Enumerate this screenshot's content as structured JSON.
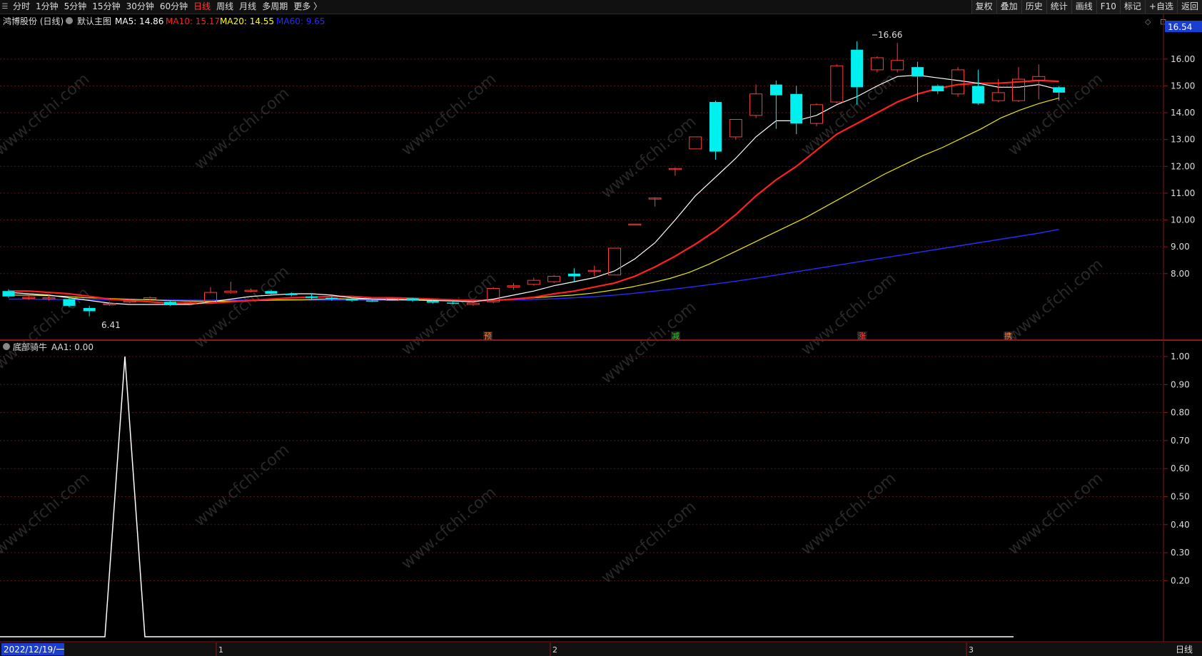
{
  "toolbar": {
    "periods": [
      "分时",
      "1分钟",
      "5分钟",
      "15分钟",
      "30分钟",
      "60分钟",
      "日线",
      "周线",
      "月线",
      "多周期",
      "更多 〉"
    ],
    "active_period": "日线",
    "right_buttons": [
      "复权",
      "叠加",
      "历史",
      "统计",
      "画线",
      "F10",
      "标记",
      "+自选",
      "返回"
    ]
  },
  "main_panel": {
    "stock_title": "鸿博股份 (日线)",
    "indicator_name": "默认主图",
    "ma_labels": [
      {
        "label": "MA5: 14.86",
        "color": "#ffffff"
      },
      {
        "label": "MA10: 15.17",
        "color": "#ff2020"
      },
      {
        "label": "MA20: 14.55",
        "color": "#ffff00"
      },
      {
        "label": "MA60: 9.65",
        "color": "#2a2aff"
      }
    ],
    "price_badge": "16.54",
    "high_label": "16.66",
    "low_label": "6.41",
    "y_ticks": [
      "16.00",
      "15.00",
      "14.00",
      "13.00",
      "12.00",
      "11.00",
      "10.00",
      "9.00",
      "8.00"
    ],
    "event_markers": [
      {
        "text": "预",
        "color": "#ff8040"
      },
      {
        "text": "减",
        "color": "#20d020"
      },
      {
        "text": "涨",
        "color": "#ff4040"
      },
      {
        "text": "携",
        "color": "#ff8040"
      }
    ],
    "watermark": "www.cfchi.com"
  },
  "sub_panel": {
    "indicator_name": "底部骑牛",
    "value_label": "AA1: 0.00",
    "y_ticks": [
      "1.00",
      "0.90",
      "0.80",
      "0.70",
      "0.60",
      "0.50",
      "0.40",
      "0.30",
      "0.20"
    ]
  },
  "bottom_bar": {
    "date_label": "2022/12/19/一",
    "month_ticks": [
      "1",
      "2",
      "3"
    ],
    "period_label": "日线"
  },
  "chart_data": {
    "type": "candlestick",
    "ylim": [
      6.0,
      16.9
    ],
    "candles": [
      {
        "o": 7.35,
        "c": 7.15,
        "h": 7.42,
        "l": 7.1
      },
      {
        "o": 7.1,
        "c": 7.12,
        "h": 7.2,
        "l": 7.02
      },
      {
        "o": 7.08,
        "c": 7.1,
        "h": 7.2,
        "l": 7.0
      },
      {
        "o": 7.05,
        "c": 6.8,
        "h": 7.1,
        "l": 6.75
      },
      {
        "o": 6.72,
        "c": 6.6,
        "h": 6.8,
        "l": 6.41
      },
      {
        "o": 6.85,
        "c": 6.88,
        "h": 6.95,
        "l": 6.8
      },
      {
        "o": 6.95,
        "c": 6.98,
        "h": 7.05,
        "l": 6.9
      },
      {
        "o": 7.05,
        "c": 7.1,
        "h": 7.15,
        "l": 7.0
      },
      {
        "o": 6.95,
        "c": 6.85,
        "h": 7.0,
        "l": 6.8
      },
      {
        "o": 6.9,
        "c": 6.92,
        "h": 6.98,
        "l": 6.85
      },
      {
        "o": 6.95,
        "c": 7.3,
        "h": 7.5,
        "l": 6.9
      },
      {
        "o": 7.3,
        "c": 7.35,
        "h": 7.7,
        "l": 7.25
      },
      {
        "o": 7.35,
        "c": 7.38,
        "h": 7.45,
        "l": 7.3
      },
      {
        "o": 7.35,
        "c": 7.25,
        "h": 7.4,
        "l": 7.2
      },
      {
        "o": 7.25,
        "c": 7.2,
        "h": 7.3,
        "l": 7.15
      },
      {
        "o": 7.15,
        "c": 7.1,
        "h": 7.25,
        "l": 7.05
      },
      {
        "o": 7.1,
        "c": 7.05,
        "h": 7.15,
        "l": 7.0
      },
      {
        "o": 7.05,
        "c": 7.0,
        "h": 7.1,
        "l": 6.95
      },
      {
        "o": 7.0,
        "c": 6.98,
        "h": 7.05,
        "l": 6.95
      },
      {
        "o": 7.0,
        "c": 7.08,
        "h": 7.12,
        "l": 6.98
      },
      {
        "o": 7.08,
        "c": 7.0,
        "h": 7.1,
        "l": 6.95
      },
      {
        "o": 6.98,
        "c": 6.92,
        "h": 7.02,
        "l": 6.88
      },
      {
        "o": 6.92,
        "c": 6.88,
        "h": 6.98,
        "l": 6.85
      },
      {
        "o": 6.85,
        "c": 6.9,
        "h": 6.95,
        "l": 6.8
      },
      {
        "o": 6.95,
        "c": 7.45,
        "h": 7.5,
        "l": 6.9
      },
      {
        "o": 7.5,
        "c": 7.55,
        "h": 7.65,
        "l": 7.4
      },
      {
        "o": 7.6,
        "c": 7.75,
        "h": 7.85,
        "l": 7.55
      },
      {
        "o": 7.7,
        "c": 7.9,
        "h": 7.95,
        "l": 7.65
      },
      {
        "o": 8.0,
        "c": 7.9,
        "h": 8.2,
        "l": 7.7
      },
      {
        "o": 8.1,
        "c": 8.12,
        "h": 8.3,
        "l": 7.9
      },
      {
        "o": 7.95,
        "c": 8.95,
        "h": 8.95,
        "l": 7.95
      },
      {
        "o": 9.85,
        "c": 9.85,
        "h": 9.85,
        "l": 9.85
      },
      {
        "o": 10.8,
        "c": 10.82,
        "h": 10.85,
        "l": 10.5
      },
      {
        "o": 11.9,
        "c": 11.92,
        "h": 11.95,
        "l": 11.65
      },
      {
        "o": 12.65,
        "c": 13.1,
        "h": 13.1,
        "l": 12.65
      },
      {
        "o": 14.4,
        "c": 12.55,
        "h": 14.45,
        "l": 12.25
      },
      {
        "o": 13.1,
        "c": 13.75,
        "h": 13.75,
        "l": 13.0
      },
      {
        "o": 13.9,
        "c": 14.7,
        "h": 15.05,
        "l": 13.8
      },
      {
        "o": 15.05,
        "c": 14.65,
        "h": 15.2,
        "l": 13.4
      },
      {
        "o": 14.7,
        "c": 13.6,
        "h": 15.0,
        "l": 13.2
      },
      {
        "o": 13.6,
        "c": 14.3,
        "h": 14.35,
        "l": 13.5
      },
      {
        "o": 14.4,
        "c": 15.75,
        "h": 15.8,
        "l": 14.35
      },
      {
        "o": 16.35,
        "c": 14.95,
        "h": 16.66,
        "l": 14.3
      },
      {
        "o": 15.6,
        "c": 16.05,
        "h": 16.1,
        "l": 15.5
      },
      {
        "o": 15.6,
        "c": 15.95,
        "h": 16.6,
        "l": 15.5
      },
      {
        "o": 15.7,
        "c": 15.35,
        "h": 15.9,
        "l": 14.4
      },
      {
        "o": 15.0,
        "c": 14.8,
        "h": 15.05,
        "l": 14.7
      },
      {
        "o": 14.7,
        "c": 15.6,
        "h": 15.7,
        "l": 14.6
      },
      {
        "o": 15.0,
        "c": 14.35,
        "h": 15.6,
        "l": 14.3
      },
      {
        "o": 14.45,
        "c": 14.75,
        "h": 15.25,
        "l": 14.4
      },
      {
        "o": 14.45,
        "c": 15.25,
        "h": 15.7,
        "l": 14.4
      },
      {
        "o": 15.2,
        "c": 15.35,
        "h": 15.8,
        "l": 14.5
      },
      {
        "o": 14.95,
        "c": 14.75,
        "h": 15.0,
        "l": 14.45
      }
    ],
    "ma5": [
      7.3,
      7.25,
      7.2,
      7.1,
      7.0,
      6.9,
      6.85,
      6.85,
      6.85,
      6.85,
      6.95,
      7.05,
      7.15,
      7.2,
      7.25,
      7.25,
      7.2,
      7.1,
      7.05,
      7.03,
      7.02,
      7.0,
      6.98,
      6.95,
      7.05,
      7.2,
      7.35,
      7.55,
      7.7,
      7.85,
      8.1,
      8.55,
      9.15,
      10.0,
      10.9,
      11.6,
      12.3,
      13.1,
      13.7,
      13.7,
      13.9,
      14.3,
      14.6,
      15.0,
      15.35,
      15.4,
      15.3,
      15.2,
      15.1,
      14.95,
      14.95,
      15.05,
      14.86
    ],
    "ma10": [
      7.35,
      7.35,
      7.3,
      7.25,
      7.15,
      7.05,
      7.0,
      6.95,
      6.9,
      6.9,
      6.9,
      6.95,
      7.0,
      7.05,
      7.1,
      7.12,
      7.15,
      7.15,
      7.1,
      7.1,
      7.08,
      7.05,
      7.02,
      7.0,
      7.0,
      7.05,
      7.12,
      7.25,
      7.35,
      7.5,
      7.65,
      7.9,
      8.25,
      8.65,
      9.1,
      9.6,
      10.2,
      10.9,
      11.5,
      12.0,
      12.6,
      13.2,
      13.6,
      14.0,
      14.4,
      14.7,
      14.9,
      15.05,
      15.1,
      15.1,
      15.15,
      15.2,
      15.17
    ],
    "ma20": [
      7.2,
      7.2,
      7.18,
      7.15,
      7.1,
      7.08,
      7.05,
      7.03,
      7.0,
      6.98,
      6.97,
      6.97,
      6.98,
      7.0,
      7.02,
      7.03,
      7.05,
      7.06,
      7.05,
      7.05,
      7.04,
      7.03,
      7.02,
      7.01,
      7.0,
      7.02,
      7.05,
      7.1,
      7.15,
      7.2,
      7.27,
      7.38,
      7.5,
      7.65,
      7.82,
      8.05,
      8.35,
      8.7,
      9.05,
      9.4,
      9.75,
      10.1,
      10.5,
      10.9,
      11.3,
      11.7,
      12.05,
      12.4,
      12.7,
      13.05,
      13.4,
      13.8,
      14.1,
      14.35,
      14.55
    ],
    "ma60": [
      7.05,
      7.05,
      7.04,
      7.04,
      7.03,
      7.03,
      7.02,
      7.02,
      7.02,
      7.01,
      7.01,
      7.01,
      7.01,
      7.01,
      7.01,
      7.01,
      7.01,
      7.01,
      7.01,
      7.01,
      7.01,
      7.01,
      7.01,
      7.01,
      7.01,
      7.02,
      7.04,
      7.06,
      7.1,
      7.14,
      7.2,
      7.27,
      7.35,
      7.43,
      7.52,
      7.62,
      7.72,
      7.83,
      7.95,
      8.07,
      8.19,
      8.31,
      8.43,
      8.55,
      8.67,
      8.79,
      8.91,
      9.03,
      9.15,
      9.27,
      9.39,
      9.51,
      9.65
    ],
    "aa1": {
      "ylim": [
        0,
        1.0
      ],
      "x": [
        0,
        147,
        175,
        203,
        1420
      ],
      "y": [
        0,
        0,
        1,
        0,
        0
      ]
    }
  }
}
